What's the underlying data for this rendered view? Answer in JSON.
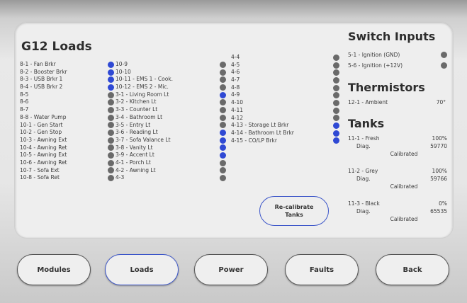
{
  "loads": {
    "title": "G12 Loads",
    "col1": [
      {
        "label": "8-1 - Fan Brkr",
        "status": "blue"
      },
      {
        "label": "8-2 - Booster Brkr",
        "status": "blue"
      },
      {
        "label": "8-3 - USB Brkr 1",
        "status": "blue"
      },
      {
        "label": "8-4 - USB Brkr 2",
        "status": "blue"
      },
      {
        "label": "8-5",
        "status": "gray"
      },
      {
        "label": "8-6",
        "status": "gray"
      },
      {
        "label": "8-7",
        "status": "gray"
      },
      {
        "label": "8-8 - Water Pump",
        "status": "gray"
      },
      {
        "label": "10-1 - Gen Start",
        "status": "gray"
      },
      {
        "label": "10-2 - Gen Stop",
        "status": "gray"
      },
      {
        "label": "10-3 - Awning Ext",
        "status": "gray"
      },
      {
        "label": "10-4 - Awning Ret",
        "status": "gray"
      },
      {
        "label": "10-5 - Awning Ext",
        "status": "gray"
      },
      {
        "label": "10-6 - Awning Ret",
        "status": "gray"
      },
      {
        "label": "10-7 - Sofa Ext",
        "status": "gray"
      },
      {
        "label": "10-8 - Sofa Ret",
        "status": "gray"
      }
    ],
    "col2": [
      {
        "label": "10-9",
        "status": "gray"
      },
      {
        "label": "10-10",
        "status": "gray"
      },
      {
        "label": "10-11 - EMS 1 - Cook.",
        "status": "gray"
      },
      {
        "label": "10-12 - EMS 2 - Mic.",
        "status": "gray"
      },
      {
        "label": "3-1 - Living Room Lt",
        "status": "blue"
      },
      {
        "label": "3-2 - Kitchen Lt",
        "status": "gray"
      },
      {
        "label": "3-3 - Counter Lt",
        "status": "gray"
      },
      {
        "label": "3-4 - Bathroom Lt",
        "status": "gray"
      },
      {
        "label": "3-5 - Entry Lt",
        "status": "gray"
      },
      {
        "label": "3-6 - Reading Lt",
        "status": "blue"
      },
      {
        "label": "3-7 - Sofa Valance Lt",
        "status": "blue"
      },
      {
        "label": "3-8 - Vanity Lt",
        "status": "blue"
      },
      {
        "label": "3-9 - Accent Lt",
        "status": "blue"
      },
      {
        "label": "4-1 - Porch Lt",
        "status": "gray"
      },
      {
        "label": "4-2 - Awning Lt",
        "status": "gray"
      },
      {
        "label": "4-3",
        "status": "gray"
      }
    ],
    "col3": [
      {
        "label": "4-4",
        "status": "gray"
      },
      {
        "label": "4-5",
        "status": "gray"
      },
      {
        "label": "4-6",
        "status": "gray"
      },
      {
        "label": "4-7",
        "status": "gray"
      },
      {
        "label": "4-8",
        "status": "gray"
      },
      {
        "label": "4-9",
        "status": "gray"
      },
      {
        "label": "4-10",
        "status": "gray"
      },
      {
        "label": "4-11",
        "status": "gray"
      },
      {
        "label": "4-12",
        "status": "gray"
      },
      {
        "label": "4-13 - Storage Lt Brkr",
        "status": "blue"
      },
      {
        "label": "4-14 - Bathroom Lt Brkr",
        "status": "blue"
      },
      {
        "label": "4-15 - CO/LP Brkr",
        "status": "blue"
      }
    ]
  },
  "switch_inputs": {
    "title": "Switch Inputs",
    "items": [
      {
        "label": "5-1 - Ignition (GND)",
        "status": "gray"
      },
      {
        "label": "5-6 - Ignition (+12V)",
        "status": "gray"
      }
    ]
  },
  "thermistors": {
    "title": "Thermistors",
    "label": "12-1 - Ambient",
    "value": "70°"
  },
  "tanks": {
    "title": "Tanks",
    "items": [
      {
        "name": "11-1 - Fresh",
        "pct": "100%",
        "diag_label": "Diag.",
        "diag": "59770",
        "status": "Calibrated"
      },
      {
        "name": "11-2 - Grey",
        "pct": "100%",
        "diag_label": "Diag.",
        "diag": "59766",
        "status": "Calibrated"
      },
      {
        "name": "11-3 - Black",
        "pct": "0%",
        "diag_label": "Diag.",
        "diag": "65535",
        "status": "Calibrated"
      }
    ]
  },
  "recalibrate_button": {
    "label": "Re-calibrate Tanks"
  },
  "nav": {
    "modules": "Modules",
    "loads": "Loads",
    "power": "Power",
    "faults": "Faults",
    "back": "Back"
  },
  "colors": {
    "on": "#2f49d4",
    "off": "#6a6a6a",
    "accent": "#3b55c9"
  }
}
